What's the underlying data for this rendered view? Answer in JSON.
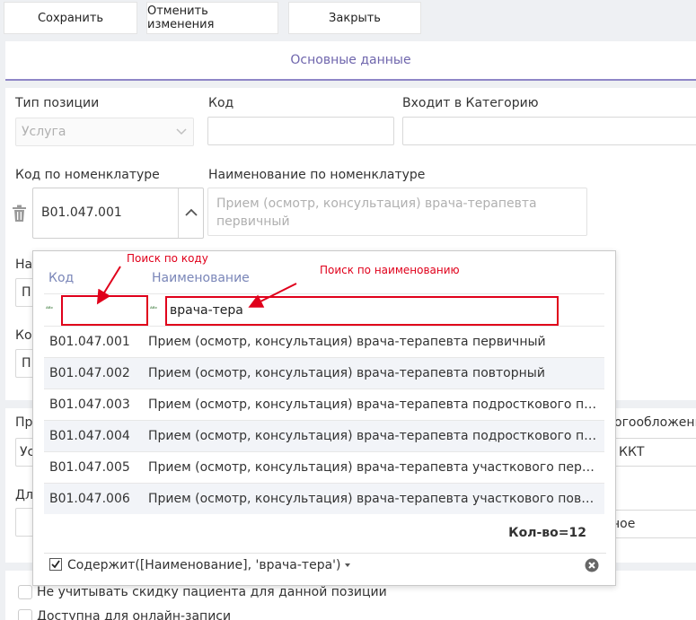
{
  "toolbar": {
    "save": "Сохранить",
    "cancel": "Отменить изменения",
    "close": "Закрыть"
  },
  "tab": {
    "label": "Основные данные"
  },
  "form": {
    "position_type_label": "Тип позиции",
    "position_type_value": "Услуга",
    "code_label": "Код",
    "category_label": "Входит в Категорию",
    "nom_code_label": "Код по номенклатуре",
    "nom_code_value": "B01.047.001",
    "nom_name_label": "Наименование по номенклатуре",
    "nom_name_value": "Прием (осмотр, консультация) врача-терапевта первичный",
    "cut_label_1": "На",
    "cut_value_1": "П",
    "cut_label_2": "Ко",
    "cut_value_2": "П",
    "cut_label_3": "Пр",
    "cut_value_3": "Ус",
    "cut_label_4": "Дл",
    "right_label_1": "огообложени",
    "right_value_1": "ККТ",
    "right_value_2": "ное",
    "checkbox_1": "Не учитывать скидку пациента для данной позиции",
    "checkbox_2": "Доступна для онлайн-записи"
  },
  "popup": {
    "col_code": "Код",
    "col_name": "Наименование",
    "filter_code_value": "",
    "filter_name_value": "врача-тера",
    "rows": [
      {
        "code": "B01.047.001",
        "name": "Прием (осмотр, консультация) врача-терапевта первичный"
      },
      {
        "code": "B01.047.002",
        "name": "Прием (осмотр, консультация) врача-терапевта повторный"
      },
      {
        "code": "B01.047.003",
        "name": "Прием (осмотр, консультация) врача-терапевта подросткового первичный"
      },
      {
        "code": "B01.047.004",
        "name": "Прием (осмотр, консультация) врача-терапевта подросткового повторный"
      },
      {
        "code": "B01.047.005",
        "name": "Прием (осмотр, консультация) врача-терапевта участкового первичный"
      },
      {
        "code": "B01.047.006",
        "name": "Прием (осмотр, консультация) врача-терапевта участкового повторный"
      }
    ],
    "count": "Кол-во=12",
    "filter_expression": "Содержит([Наименование], 'врача-тера')"
  },
  "annotations": {
    "search_code": "Поиск по коду",
    "search_name": "Поиск по наименованию"
  },
  "colors": {
    "accent": "#6f66ad",
    "annotation": "#e0001b"
  }
}
